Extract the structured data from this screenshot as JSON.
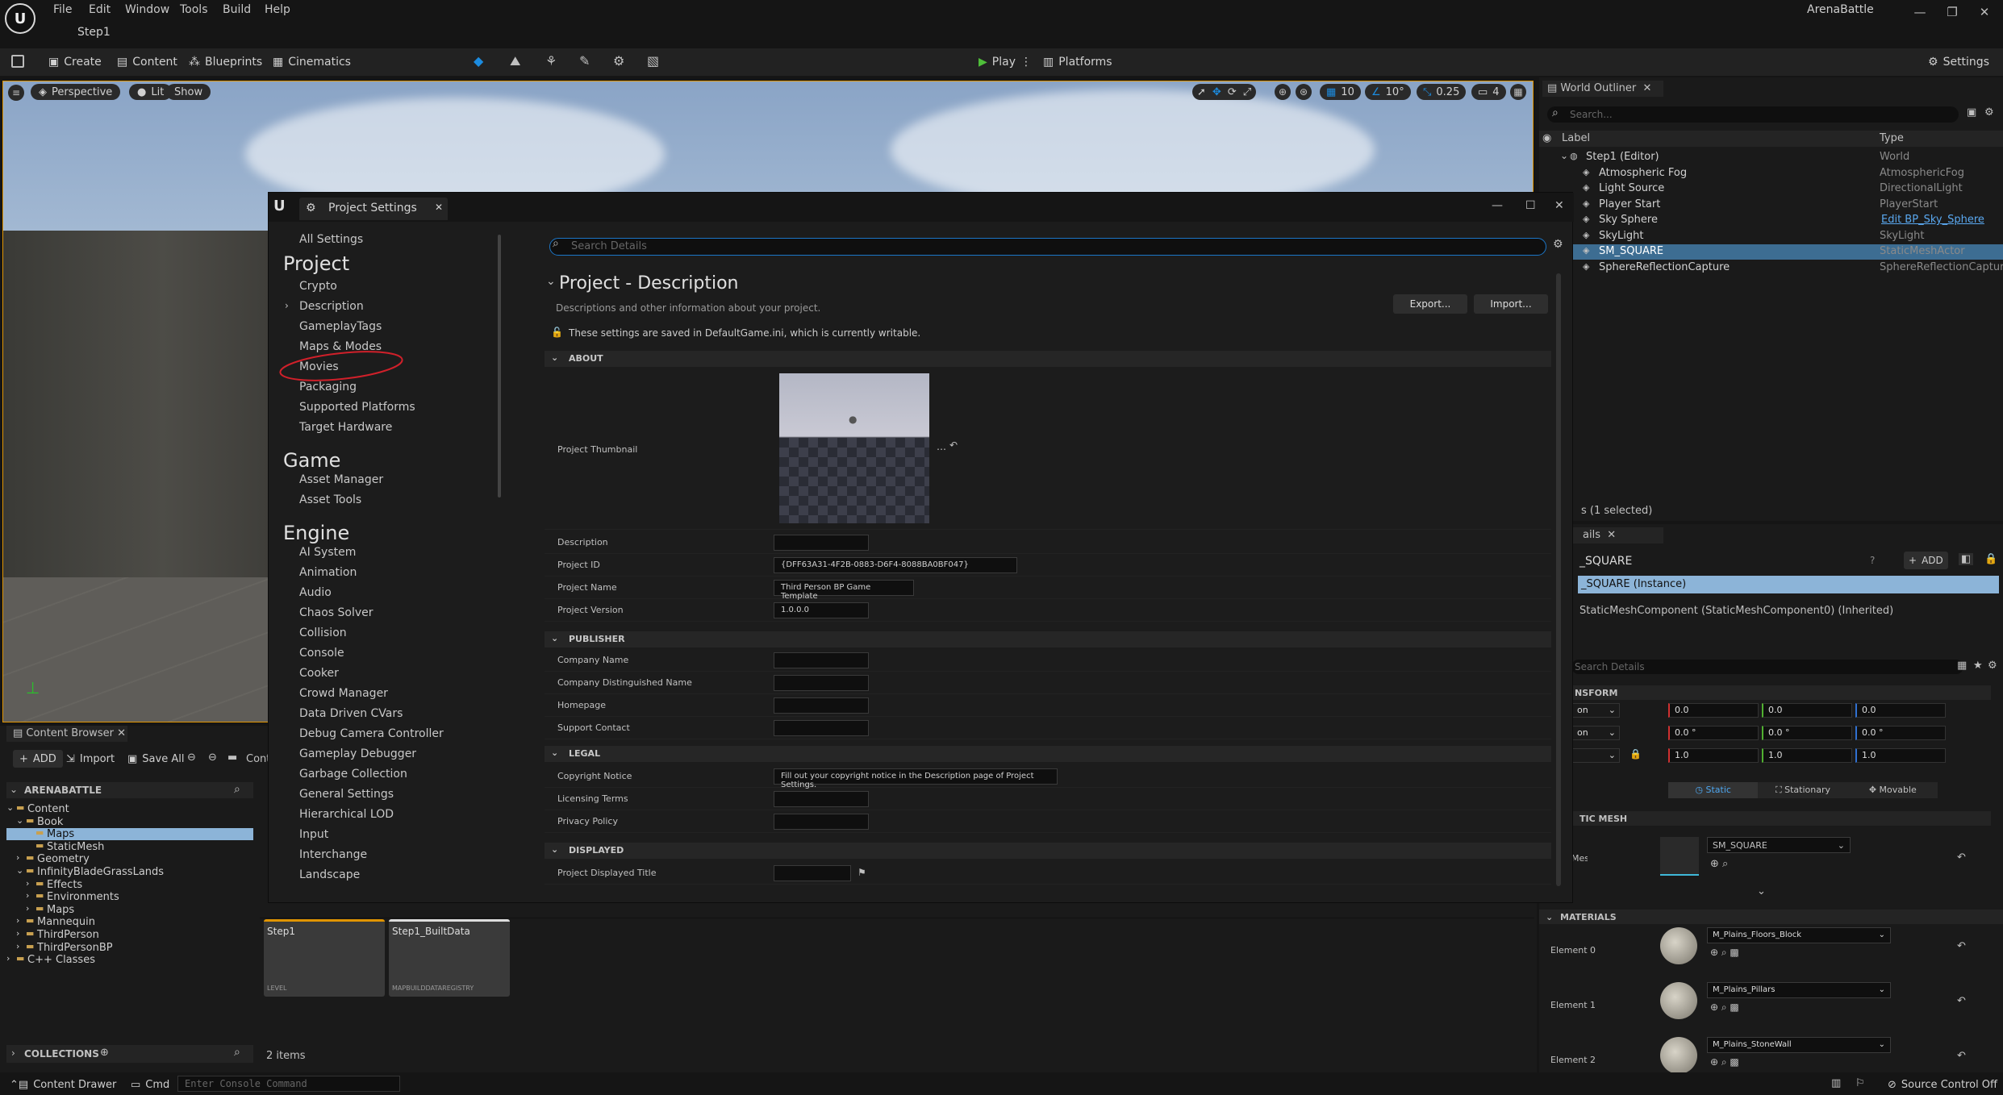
{
  "app": {
    "title": "ArenaBattle",
    "level_tab": "Step1",
    "logo": "U"
  },
  "menu": [
    "File",
    "Edit",
    "Window",
    "Tools",
    "Build",
    "Help"
  ],
  "toolbar": {
    "create": "Create",
    "content": "Content",
    "blueprints": "Blueprints",
    "cinematics": "Cinematics",
    "play": "Play",
    "platforms": "Platforms",
    "settings": "Settings"
  },
  "viewport": {
    "perspective": "Perspective",
    "lit": "Lit",
    "show": "Show",
    "grid": "10",
    "angle": "10°",
    "scale": "0.25",
    "cams": "4"
  },
  "dialog": {
    "title": "Project Settings",
    "nav": {
      "all": "All Settings",
      "project_header": "Project",
      "project_items": [
        "Crypto",
        "Description",
        "GameplayTags",
        "Maps & Modes",
        "Movies",
        "Packaging",
        "Supported Platforms",
        "Target Hardware"
      ],
      "game_header": "Game",
      "game_items": [
        "Asset Manager",
        "Asset Tools"
      ],
      "engine_header": "Engine",
      "engine_items": [
        "AI System",
        "Animation",
        "Audio",
        "Chaos Solver",
        "Collision",
        "Console",
        "Cooker",
        "Crowd Manager",
        "Data Driven CVars",
        "Debug Camera Controller",
        "Gameplay Debugger",
        "Garbage Collection",
        "General Settings",
        "Hierarchical LOD",
        "Input",
        "Interchange",
        "Landscape"
      ]
    },
    "search_placeholder": "Search Details",
    "heading": "Project - Description",
    "subheading": "Descriptions and other information about your project.",
    "export": "Export...",
    "import": "Import...",
    "notice": "These settings are saved in DefaultGame.ini, which is currently writable.",
    "sections": {
      "about": "ABOUT",
      "publisher": "PUBLISHER",
      "legal": "LEGAL",
      "displayed": "DISPLAYED"
    },
    "about_rows": {
      "thumbnail": "Project Thumbnail",
      "description": "Description",
      "project_id_label": "Project ID",
      "project_id": "{DFF63A31-4F2B-0883-D6F4-8088BA0BF047}",
      "project_name_label": "Project Name",
      "project_name": "Third Person BP Game Template",
      "project_version_label": "Project Version",
      "project_version": "1.0.0.0"
    },
    "publisher_rows": [
      "Company Name",
      "Company Distinguished Name",
      "Homepage",
      "Support Contact"
    ],
    "legal_rows": {
      "copyright_label": "Copyright Notice",
      "copyright": "Fill out your copyright notice in the Description page of Project Settings.",
      "licensing": "Licensing Terms",
      "privacy": "Privacy Policy"
    },
    "displayed_rows": {
      "title_label": "Project Displayed Title"
    }
  },
  "outliner": {
    "title": "World Outliner",
    "search": "Search...",
    "col_label": "Label",
    "col_type": "Type",
    "rows": [
      {
        "name": "Step1 (Editor)",
        "type": "World"
      },
      {
        "name": "Atmospheric Fog",
        "type": "AtmosphericFog"
      },
      {
        "name": "Light Source",
        "type": "DirectionalLight"
      },
      {
        "name": "Player Start",
        "type": "PlayerStart"
      },
      {
        "name": "Sky Sphere",
        "type": "Edit BP_Sky_Sphere"
      },
      {
        "name": "SkyLight",
        "type": "SkyLight"
      },
      {
        "name": "SM_SQUARE",
        "type": "StaticMeshActor"
      },
      {
        "name": "SphereReflectionCapture",
        "type": "SphereReflectionCapture"
      }
    ],
    "footer": "s (1 selected)"
  },
  "details": {
    "tab": "ails",
    "actor": "_SQUARE",
    "add": "ADD",
    "instance": "_SQUARE (Instance)",
    "component": "StaticMeshComponent (StaticMeshComponent0) (Inherited)",
    "search": "Search Details",
    "transform": "NSFORM",
    "loc_dd": "on",
    "rot_dd": "on",
    "loc": [
      "0.0",
      "0.0",
      "0.0"
    ],
    "rot": [
      "0.0 °",
      "0.0 °",
      "0.0 °"
    ],
    "scale": [
      "1.0",
      "1.0",
      "1.0"
    ],
    "mobility": [
      "Static",
      "Stationary",
      "Movable"
    ],
    "static_mesh_section": "TIC MESH",
    "mesh_label": "Mesh",
    "mesh": "SM_SQUARE",
    "materials_section": "MATERIALS",
    "materials": [
      {
        "label": "Element 0",
        "name": "M_Plains_Floors_Block"
      },
      {
        "label": "Element 1",
        "name": "M_Plains_Pillars"
      },
      {
        "label": "Element 2",
        "name": "M_Plains_StoneWall"
      }
    ]
  },
  "content_browser": {
    "tab": "Content Browser",
    "add": "ADD",
    "import": "Import",
    "save_all": "Save All",
    "path": "Cont",
    "root": "ARENABATTLE",
    "tree": [
      {
        "label": "Content",
        "depth": 0
      },
      {
        "label": "Book",
        "depth": 1
      },
      {
        "label": "Maps",
        "depth": 2
      },
      {
        "label": "StaticMesh",
        "depth": 2
      },
      {
        "label": "Geometry",
        "depth": 1
      },
      {
        "label": "InfinityBladeGrassLands",
        "depth": 1
      },
      {
        "label": "Effects",
        "depth": 2
      },
      {
        "label": "Environments",
        "depth": 2
      },
      {
        "label": "Maps",
        "depth": 2
      },
      {
        "label": "Mannequin",
        "depth": 1
      },
      {
        "label": "ThirdPerson",
        "depth": 1
      },
      {
        "label": "ThirdPersonBP",
        "depth": 1
      },
      {
        "label": "C++ Classes",
        "depth": 0
      }
    ],
    "collections": "COLLECTIONS",
    "assets": [
      {
        "name": "Step1",
        "type": "LEVEL"
      },
      {
        "name": "Step1_BuiltData",
        "type": "MAPBUILDDATAREGISTRY"
      }
    ],
    "count": "2 items"
  },
  "status": {
    "drawer": "Content Drawer",
    "cmd": "Cmd",
    "console_placeholder": "Enter Console Command",
    "source_control": "Source Control Off"
  },
  "colors": {
    "accent": "#1c76c7",
    "selection": "#e09400",
    "annotation": "#d0202a"
  }
}
